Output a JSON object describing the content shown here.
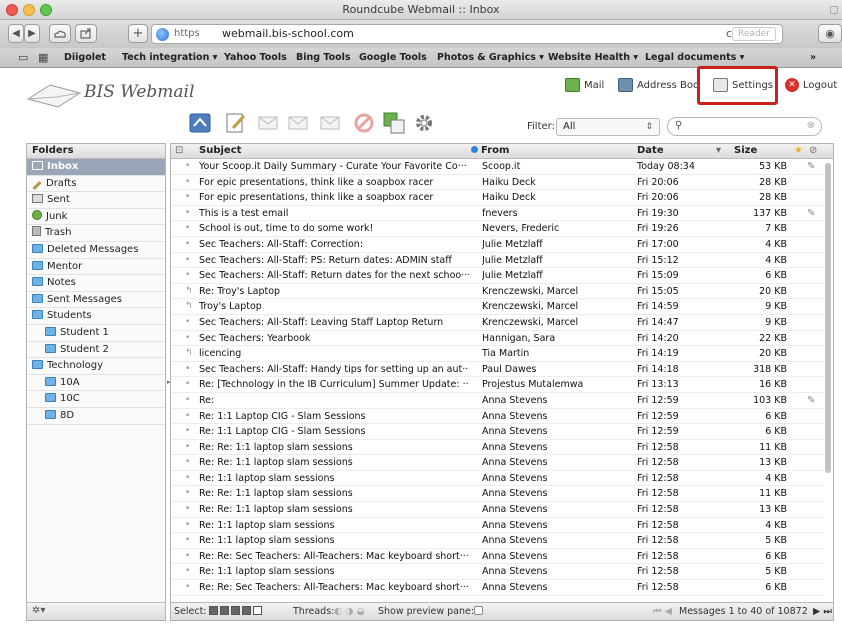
{
  "window": {
    "title": "Roundcube Webmail :: Inbox"
  },
  "browser": {
    "nav_back": "◀",
    "nav_forward": "▶",
    "new_tab": "+",
    "url_scheme": "https",
    "url_host": "webmail.bis-school.com",
    "reader": "Reader",
    "reload": "c",
    "bookmarks": [
      "Diigolet",
      "Tech integration ▾",
      "Yahoo Tools",
      "Bing Tools",
      "Google Tools",
      "Photos & Graphics ▾",
      "Website Health ▾",
      "Legal documents ▾"
    ],
    "overflow": "»"
  },
  "app": {
    "logo_text": "BIS Webmail",
    "taskbar": {
      "mail": "Mail",
      "address_book": "Address Boo",
      "settings": "Settings",
      "logout": "Logout"
    }
  },
  "filter": {
    "label": "Filter:",
    "value": "All"
  },
  "search": {
    "placeholder": ""
  },
  "folders": {
    "header": "Folders",
    "items": [
      "Inbox",
      "Drafts",
      "Sent",
      "Junk",
      "Trash",
      "Deleted Messages",
      "Mentor",
      "Notes",
      "Sent Messages",
      "Students",
      "Student 1",
      "Student 2",
      "Technology",
      "10A",
      "10C",
      "8D"
    ]
  },
  "list": {
    "headers": {
      "subject": "Subject",
      "from": "From",
      "date": "Date",
      "size": "Size"
    },
    "rows": [
      {
        "status": "•",
        "subject": "Your Scoop.it Daily Summary - Curate Your Favorite Co···",
        "from": "Scoop.it",
        "date": "Today 08:34",
        "size": "53 KB",
        "attach": "✎"
      },
      {
        "status": "•",
        "subject": "For epic presentations, think like a soapbox racer",
        "from": "Haiku Deck",
        "date": "Fri 20:06",
        "size": "28 KB",
        "attach": ""
      },
      {
        "status": "•",
        "subject": "For epic presentations, think like a soapbox racer",
        "from": "Haiku Deck",
        "date": "Fri 20:06",
        "size": "28 KB",
        "attach": ""
      },
      {
        "status": "•",
        "subject": "This is a test email",
        "from": "fnevers",
        "date": "Fri 19:30",
        "size": "137 KB",
        "attach": "✎"
      },
      {
        "status": "•",
        "subject": "School is out, time to do some work!",
        "from": "Nevers, Frederic",
        "date": "Fri 19:26",
        "size": "7 KB",
        "attach": ""
      },
      {
        "status": "•",
        "subject": "Sec Teachers: All-Staff: Correction:",
        "from": "Julie Metzlaff",
        "date": "Fri 17:00",
        "size": "4 KB",
        "attach": ""
      },
      {
        "status": "•",
        "subject": "Sec Teachers: All-Staff: PS: Return dates: ADMIN staff",
        "from": "Julie Metzlaff",
        "date": "Fri 15:12",
        "size": "4 KB",
        "attach": ""
      },
      {
        "status": "•",
        "subject": "Sec Teachers: All-Staff: Return dates for the next schoo···",
        "from": "Julie Metzlaff",
        "date": "Fri 15:09",
        "size": "6 KB",
        "attach": ""
      },
      {
        "status": "↰",
        "subject": "Re: Troy's Laptop",
        "from": "Krenczewski, Marcel",
        "date": "Fri 15:05",
        "size": "20 KB",
        "attach": ""
      },
      {
        "status": "↰",
        "subject": "Troy's Laptop",
        "from": "Krenczewski, Marcel",
        "date": "Fri 14:59",
        "size": "9 KB",
        "attach": ""
      },
      {
        "status": "•",
        "subject": "Sec Teachers: All-Staff: Leaving Staff Laptop Return",
        "from": "Krenczewski, Marcel",
        "date": "Fri 14:47",
        "size": "9 KB",
        "attach": ""
      },
      {
        "status": "•",
        "subject": "Sec Teachers: Yearbook",
        "from": "Hannigan, Sara",
        "date": "Fri 14:20",
        "size": "22 KB",
        "attach": ""
      },
      {
        "status": "↰",
        "subject": "licencing",
        "from": "Tia Martin",
        "date": "Fri 14:19",
        "size": "20 KB",
        "attach": ""
      },
      {
        "status": "•",
        "subject": "Sec Teachers: All-Staff: Handy tips for setting up an aut···",
        "from": "Paul Dawes",
        "date": "Fri 14:18",
        "size": "318 KB",
        "attach": ""
      },
      {
        "status": "•",
        "subject": "Re: [Technology in the IB Curriculum] Summer Update: ···",
        "from": "Projestus Mutalemwa",
        "date": "Fri 13:13",
        "size": "16 KB",
        "attach": ""
      },
      {
        "status": "•",
        "subject": "Re:",
        "from": "Anna Stevens",
        "date": "Fri 12:59",
        "size": "103 KB",
        "attach": "✎"
      },
      {
        "status": "•",
        "subject": "Re: 1:1 Laptop CIG - Slam Sessions",
        "from": "Anna Stevens",
        "date": "Fri 12:59",
        "size": "6 KB",
        "attach": ""
      },
      {
        "status": "•",
        "subject": "Re: 1:1 Laptop CIG - Slam Sessions",
        "from": "Anna Stevens",
        "date": "Fri 12:59",
        "size": "6 KB",
        "attach": ""
      },
      {
        "status": "•",
        "subject": "Re: Re: 1:1 laptop slam sessions",
        "from": "Anna Stevens",
        "date": "Fri 12:58",
        "size": "11 KB",
        "attach": ""
      },
      {
        "status": "•",
        "subject": "Re: Re: 1:1 laptop slam sessions",
        "from": "Anna Stevens",
        "date": "Fri 12:58",
        "size": "13 KB",
        "attach": ""
      },
      {
        "status": "•",
        "subject": "Re: 1:1 laptop slam sessions",
        "from": "Anna Stevens",
        "date": "Fri 12:58",
        "size": "4 KB",
        "attach": ""
      },
      {
        "status": "•",
        "subject": "Re: Re: 1:1 laptop slam sessions",
        "from": "Anna Stevens",
        "date": "Fri 12:58",
        "size": "11 KB",
        "attach": ""
      },
      {
        "status": "•",
        "subject": "Re: Re: 1:1 laptop slam sessions",
        "from": "Anna Stevens",
        "date": "Fri 12:58",
        "size": "13 KB",
        "attach": ""
      },
      {
        "status": "•",
        "subject": "Re: 1:1 laptop slam sessions",
        "from": "Anna Stevens",
        "date": "Fri 12:58",
        "size": "4 KB",
        "attach": ""
      },
      {
        "status": "•",
        "subject": "Re: 1:1 laptop slam sessions",
        "from": "Anna Stevens",
        "date": "Fri 12:58",
        "size": "5 KB",
        "attach": ""
      },
      {
        "status": "•",
        "subject": "Re: Re: Sec Teachers: All-Teachers: Mac keyboard short···",
        "from": "Anna Stevens",
        "date": "Fri 12:58",
        "size": "6 KB",
        "attach": ""
      },
      {
        "status": "•",
        "subject": "Re: 1:1 laptop slam sessions",
        "from": "Anna Stevens",
        "date": "Fri 12:58",
        "size": "5 KB",
        "attach": ""
      },
      {
        "status": "•",
        "subject": "Re: Re: Sec Teachers: All-Teachers: Mac keyboard short···",
        "from": "Anna Stevens",
        "date": "Fri 12:58",
        "size": "6 KB",
        "attach": ""
      }
    ],
    "footer": {
      "select_label": "Select:",
      "threads_label": "Threads:",
      "preview_label": "Show preview pane:",
      "pager_prev": "⏮ ◀",
      "count_text": "Messages 1 to 40 of 10872",
      "pager_next": "▶ ⏭"
    }
  },
  "colors": {
    "highlight": "#c9211b",
    "selected_folder": "#9aa6b7",
    "unread_dot": "#2a84e0"
  }
}
